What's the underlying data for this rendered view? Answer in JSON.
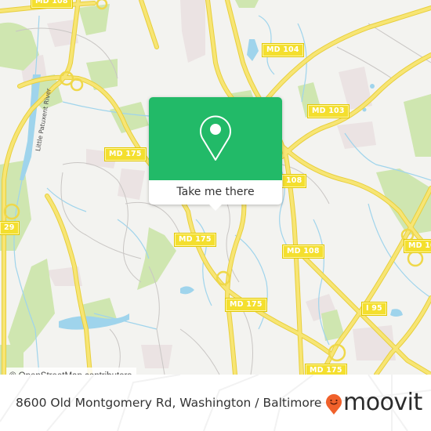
{
  "map": {
    "road_labels": [
      {
        "id": "md108-top",
        "text": "MD 108"
      },
      {
        "id": "md108-left",
        "text": "MD 108"
      },
      {
        "id": "md104",
        "text": "MD 104"
      },
      {
        "id": "md103",
        "text": "MD 103"
      },
      {
        "id": "md175-nw",
        "text": "MD 175"
      },
      {
        "id": "md108-mid",
        "text": "108"
      },
      {
        "id": "us29",
        "text": "29"
      },
      {
        "id": "md175-center",
        "text": "MD 175"
      },
      {
        "id": "md108-east",
        "text": "MD 108"
      },
      {
        "id": "md108-far-east",
        "text": "MD 10"
      },
      {
        "id": "md175-south",
        "text": "MD 175"
      },
      {
        "id": "i95",
        "text": "I 95"
      },
      {
        "id": "md175-bottom",
        "text": "MD 175"
      }
    ],
    "water_labels": [
      {
        "text": "Little Patuxent River"
      }
    ],
    "attribution": "© OpenStreetMap contributors",
    "colors": {
      "background": "#f3f3f0",
      "park": "#cfe6b0",
      "water": "#9fd4ec",
      "road": "#f5e161",
      "urban": "#ebe3e3"
    }
  },
  "popup": {
    "icon": "map-pin-icon",
    "action_label": "Take me there",
    "accent_color": "#22ba68"
  },
  "footer": {
    "address": "8600 Old Montgomery Rd, Washington / Baltimore",
    "brand": {
      "name": "moovit",
      "icon": "moovit-smiley-pin-icon",
      "color": "#f0612b"
    }
  }
}
